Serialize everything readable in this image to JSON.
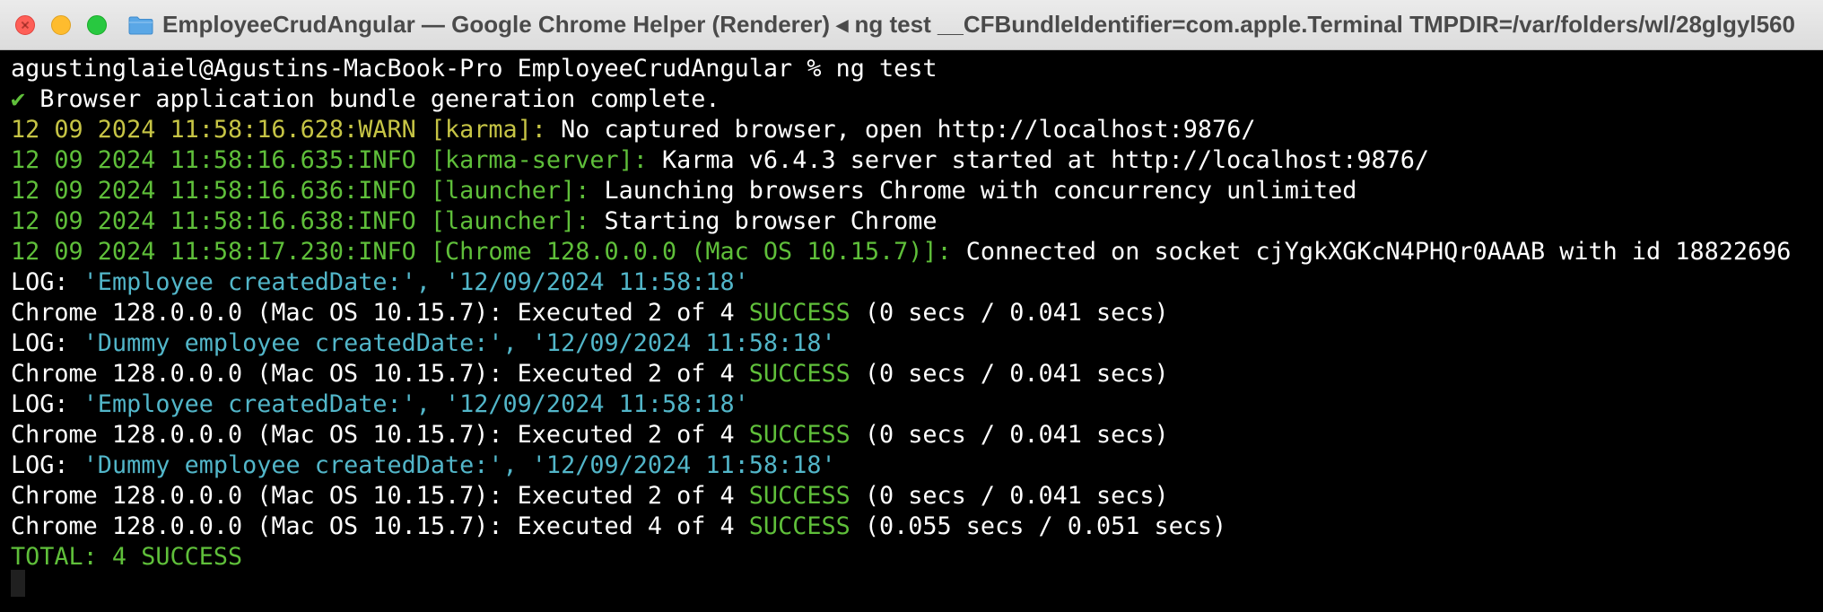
{
  "window": {
    "title": "EmployeeCrudAngular — Google Chrome Helper (Renderer) ◂ ng test __CFBundleIdentifier=com.apple.Terminal TMPDIR=/var/folders/wl/28glgyl560",
    "folder_icon": "folder-icon",
    "colors": {
      "close": "#fe5f57",
      "minimize": "#febc2e",
      "maximize": "#28c840"
    }
  },
  "terminal": {
    "colors": {
      "background": "#000000",
      "text": "#ffffff",
      "warn": "#c6c445",
      "info": "#5fbf3a",
      "string": "#52b6c9"
    },
    "prompt": "agustinglaiel@Agustins-MacBook-Pro EmployeeCrudAngular % ng test",
    "bundle": {
      "check": "✔",
      "text": " Browser application bundle generation complete."
    },
    "warn_line": {
      "prefix": "12 09 2024 11:58:16.628:WARN [karma]:",
      "message": " No captured browser, open http://localhost:9876/"
    },
    "info_lines": [
      {
        "prefix": "12 09 2024 11:58:16.635:INFO [karma-server]:",
        "message": " Karma v6.4.3 server started at http://localhost:9876/"
      },
      {
        "prefix": "12 09 2024 11:58:16.636:INFO [launcher]:",
        "message": " Launching browsers Chrome with concurrency unlimited"
      },
      {
        "prefix": "12 09 2024 11:58:16.638:INFO [launcher]:",
        "message": " Starting browser Chrome"
      },
      {
        "prefix": "12 09 2024 11:58:17.230:INFO [Chrome 128.0.0.0 (Mac OS 10.15.7)]:",
        "message": " Connected on socket cjYgkXGKcN4PHQr0AAAB with id 18822696"
      }
    ],
    "logs": [
      {
        "label": "LOG: ",
        "text": "'Employee createdDate:', '12/09/2024 11:58:18'"
      },
      {
        "label": "LOG: ",
        "text": "'Dummy employee createdDate:', '12/09/2024 11:58:18'"
      },
      {
        "label": "LOG: ",
        "text": "'Employee createdDate:', '12/09/2024 11:58:18'"
      },
      {
        "label": "LOG: ",
        "text": "'Dummy employee createdDate:', '12/09/2024 11:58:18'"
      }
    ],
    "results": [
      {
        "pre": "Chrome 128.0.0.0 (Mac OS 10.15.7): Executed 2 of 4 ",
        "status": "SUCCESS",
        "post": " (0 secs / 0.041 secs)"
      },
      {
        "pre": "Chrome 128.0.0.0 (Mac OS 10.15.7): Executed 2 of 4 ",
        "status": "SUCCESS",
        "post": " (0 secs / 0.041 secs)"
      },
      {
        "pre": "Chrome 128.0.0.0 (Mac OS 10.15.7): Executed 2 of 4 ",
        "status": "SUCCESS",
        "post": " (0 secs / 0.041 secs)"
      },
      {
        "pre": "Chrome 128.0.0.0 (Mac OS 10.15.7): Executed 2 of 4 ",
        "status": "SUCCESS",
        "post": " (0 secs / 0.041 secs)"
      },
      {
        "pre": "Chrome 128.0.0.0 (Mac OS 10.15.7): Executed 4 of 4 ",
        "status": "SUCCESS",
        "post": " (0.055 secs / 0.051 secs)"
      }
    ],
    "total": "TOTAL: 4 SUCCESS"
  }
}
